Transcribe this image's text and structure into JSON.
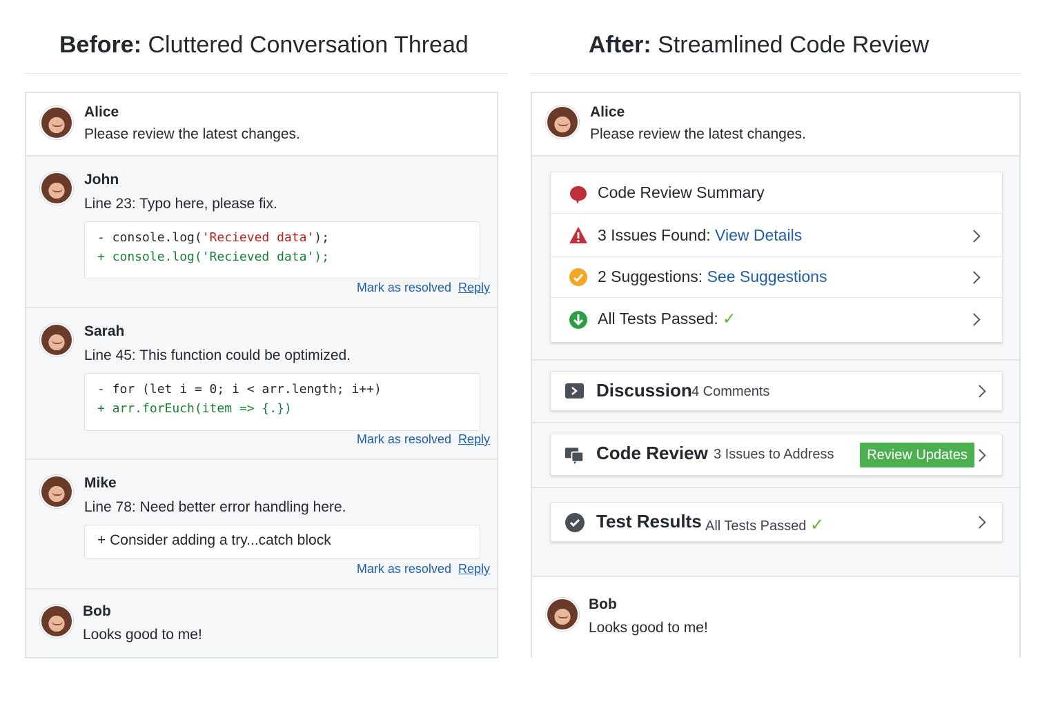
{
  "before": {
    "heading_bold": "Before:",
    "heading_rest": "Cluttered Conversation Thread",
    "messages": [
      {
        "author": "Alice",
        "text": "Please review the latest changes."
      },
      {
        "author": "John",
        "text": "Line 23: Typo here, please fix.",
        "code": {
          "del_prefix": "- console.log(",
          "del_string": "'Recieved data'",
          "del_suffix": ");",
          "add": "+ console.log('Recieved data');"
        }
      },
      {
        "author": "Sarah",
        "text": "Line 45: This function could be optimized.",
        "code": {
          "del": "- for (let i = 0; i < arr.length; i++)",
          "add": "+ arr.forEuch(item => {.})"
        }
      },
      {
        "author": "Mike",
        "text": "Line 78: Need better error handling here.",
        "note": "+ Consider adding a try...catch block"
      },
      {
        "author": "Bob",
        "text": "Looks good to me!"
      }
    ],
    "mark_resolved_label": "Mark as resolved",
    "reply_label": "Reply"
  },
  "after": {
    "heading_bold": "After:",
    "heading_rest": "Streamlined Code Review",
    "first_message": {
      "author": "Alice",
      "text": "Please review the latest changes."
    },
    "summary": {
      "title": "Code Review Summary",
      "issues_label": "3 Issues Found:",
      "issues_link": "View Details",
      "suggestions_label": "2 Suggestions:",
      "suggestions_link": "See Suggestions",
      "tests_label": "All Tests Passed:",
      "check": "✓"
    },
    "discussion": {
      "title": "Discussion",
      "sub": "4 Comments"
    },
    "code_review": {
      "title": "Code Review",
      "sub": "3 Issues to Address",
      "button": "Review Updates"
    },
    "test_results": {
      "title": "Test Results",
      "sub": "All Tests Passed",
      "check": "✓"
    },
    "last_message": {
      "author": "Bob",
      "text": "Looks good to me!"
    }
  },
  "colors": {
    "link": "#1f5fa8",
    "added": "#1a7f37",
    "removed_string": "#b3261e",
    "button": "#4caf50",
    "warning": "#c0303a",
    "suggestion": "#f5a623",
    "success": "#2e9e44"
  },
  "icons": [
    "avatar",
    "speech-bubble-icon",
    "warning-icon",
    "suggestion-icon",
    "download-check-icon",
    "checkmark-icon",
    "discussion-icon",
    "code-review-icon",
    "check-circle-icon",
    "chevron-right-icon"
  ]
}
